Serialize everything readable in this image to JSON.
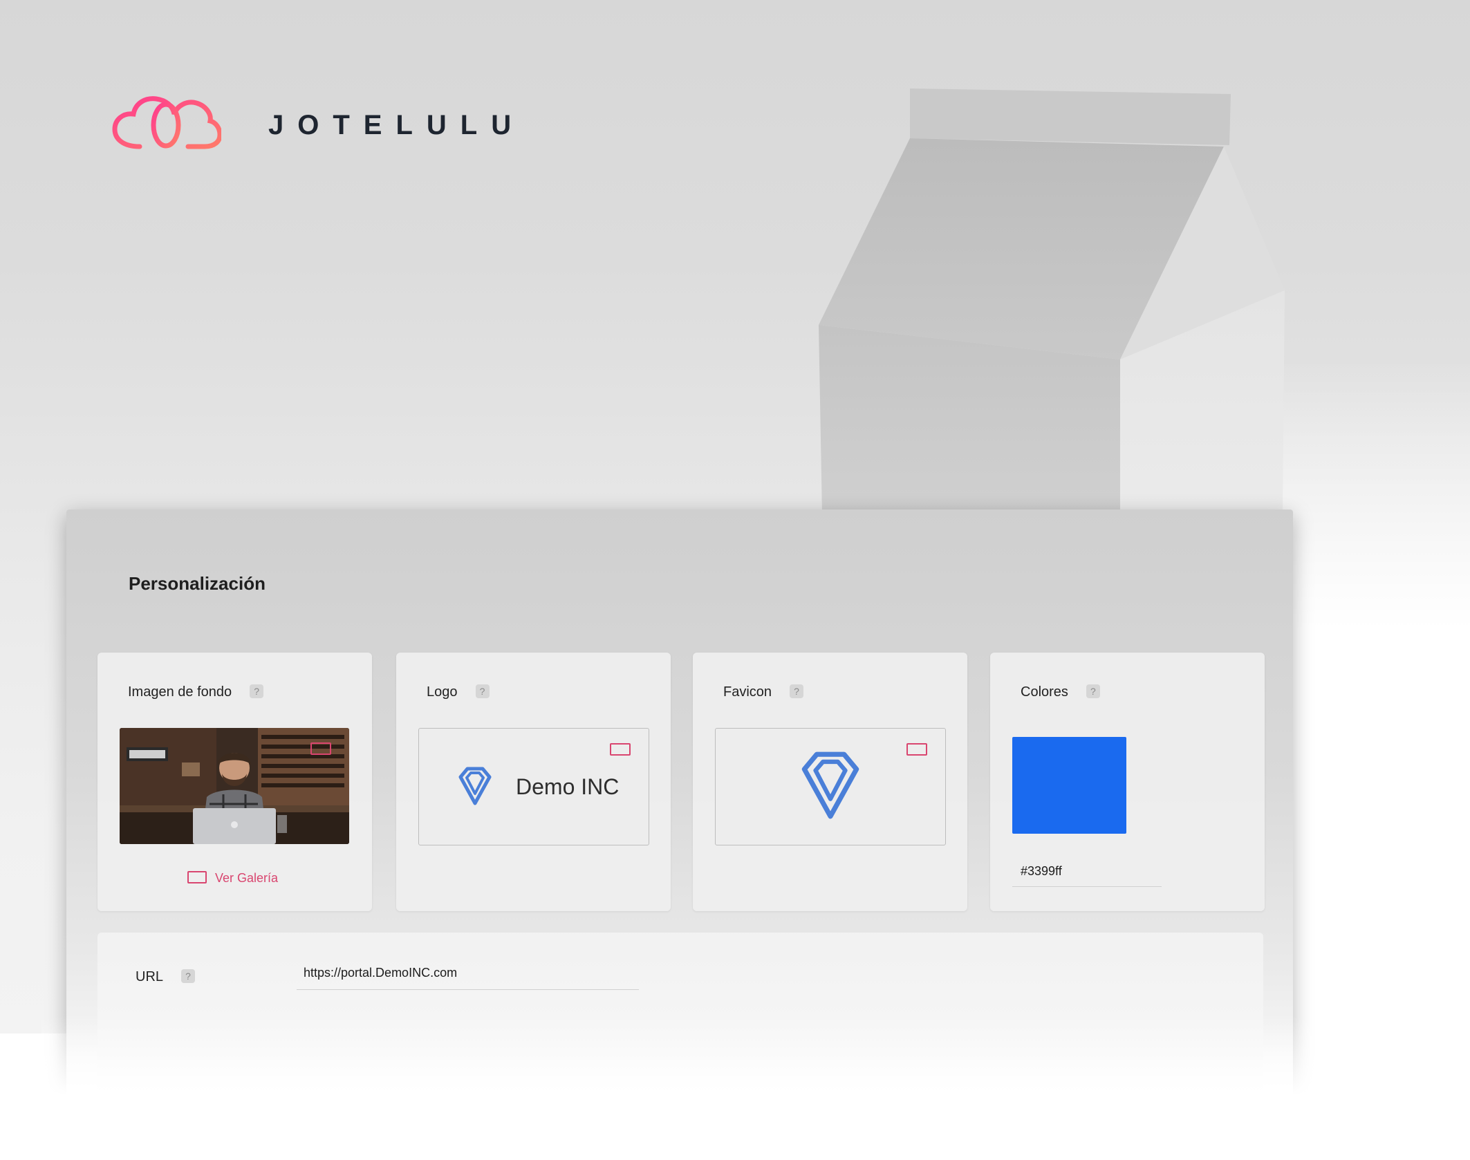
{
  "brand": {
    "name": "JOTELULU",
    "logo_icon": "cloud-logo-icon",
    "accent_color": "#ff4f8b"
  },
  "panel": {
    "title": "Personalización",
    "cards": {
      "background": {
        "label": "Imagen de fondo",
        "help": "?",
        "image": "cafe-laptop-photo",
        "gallery_link": "Ver Galería"
      },
      "logo": {
        "label": "Logo",
        "help": "?",
        "preview_text": "Demo INC",
        "icon": "diamond-icon"
      },
      "favicon": {
        "label": "Favicon",
        "help": "?",
        "icon": "diamond-icon"
      },
      "colors": {
        "label": "Colores",
        "help": "?",
        "swatch_color": "#1a6aef",
        "hex_value": "#3399ff"
      }
    },
    "url": {
      "label": "URL",
      "help": "?",
      "value": "https://portal.DemoINC.com"
    }
  },
  "colors": {
    "link_accent": "#d9456f",
    "icon_blue": "#4a7fd8"
  }
}
